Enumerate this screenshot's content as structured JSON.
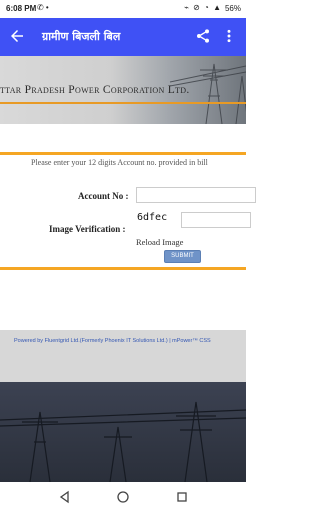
{
  "status_bar": {
    "time": "6:08 PM",
    "left_icons": "✆ •",
    "right_icons": "⌁ ⊘ ◔ ▲",
    "battery": "56%"
  },
  "app_bar": {
    "title": "ग्रामीण बिजली बिल",
    "back_icon": "arrow-left",
    "share_icon": "share",
    "more_icon": "more-vertical"
  },
  "banner": {
    "title": "ttar Pradesh Power Corporation Ltd."
  },
  "form": {
    "instruction": "Please enter your 12 digits Account no. provided in bill",
    "account_label": "Account No :",
    "account_value": "",
    "image_label": "Image Verification :",
    "captcha_text": "6dfec",
    "captcha_value": "",
    "reload_label": "Reload Image",
    "submit_label": "SUBMIT"
  },
  "footer": {
    "powered_by": "Powered by Fluentgrid Ltd.(Formerly Phoenix IT Solutions Ltd.) | mPower™ CSS"
  },
  "colors": {
    "app_bar": "#3f51f5",
    "accent_line": "#f5a623",
    "submit": "#6f93c8",
    "footer_bg": "#d7d7d7",
    "dark_bg": "#2a2f3a"
  }
}
